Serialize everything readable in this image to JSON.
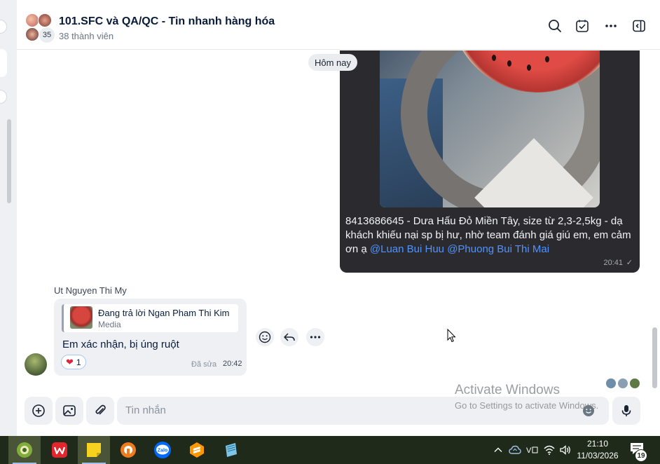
{
  "header": {
    "title": "101.SFC và QA/QC - Tin nhanh hàng hóa",
    "member_count": "38 thành viên",
    "avatar_overflow": "35",
    "icons": [
      "search-icon",
      "task-check-icon",
      "more-icon",
      "toggle-panel-icon"
    ]
  },
  "chat": {
    "date_chip": "Hôm nay",
    "outgoing": {
      "text": "8413686645 - Dưa Hấu Đỏ Miền Tây, size từ 2,3-2,5kg - dạ khách khiếu nại sp bị hư, nhờ team đánh giá giú em, em cảm ơn ạ",
      "mention_1": "@Luan Bui Huu",
      "mention_2": "@Phuong Bui Thi Mai",
      "time": "20:41"
    },
    "incoming": {
      "sender": "Ut Nguyen Thi My",
      "reply_title": "Đang trả lời Ngan Pham Thi Kim",
      "reply_sub": "Media",
      "text": "Em xác nhận, bị úng ruột",
      "reaction_count": "1",
      "edited_label": "Đã sửa",
      "time": "20:42"
    }
  },
  "input": {
    "placeholder": "Tin nhắn"
  },
  "watermark": {
    "line1": "Activate Windows",
    "line2": "Go to Settings to activate Windows."
  },
  "taskbar": {
    "apps": [
      "app-icon",
      "wps-office-icon",
      "sticky-notes-icon",
      "browser-icon",
      "zalo-icon",
      "sublime-icon",
      "notepad-icon"
    ],
    "lang_label": "ⅴ",
    "time": "21:10",
    "date": "11/03/2026",
    "notification_count": "19"
  }
}
